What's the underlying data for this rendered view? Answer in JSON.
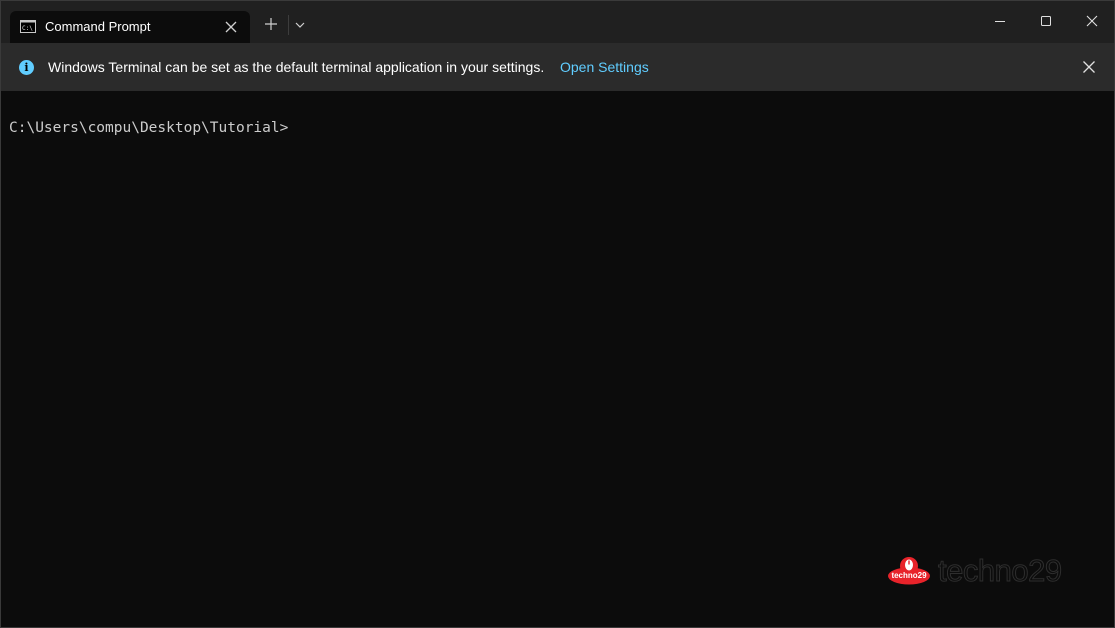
{
  "tab": {
    "title": "Command Prompt",
    "icon": "cmd-icon"
  },
  "titlebar": {
    "new_tab_icon": "plus-icon",
    "dropdown_icon": "chevron-down-icon",
    "minimize_icon": "minimize-icon",
    "maximize_icon": "maximize-icon",
    "close_icon": "close-icon"
  },
  "infobar": {
    "icon": "info-icon",
    "icon_glyph": "i",
    "message": "Windows Terminal can be set as the default terminal application in your settings.",
    "link_label": "Open Settings",
    "close_icon": "close-icon"
  },
  "terminal": {
    "prompt": "C:\\Users\\compu\\Desktop\\Tutorial>"
  },
  "watermark": {
    "badge_text": "techno29",
    "text": "techno29"
  },
  "colors": {
    "accent": "#60cdff",
    "terminal_bg": "#0c0c0c",
    "titlebar_bg": "#202020",
    "infobar_bg": "#2b2b2b",
    "terminal_fg": "#cccccc",
    "watermark_red": "#e8232a"
  }
}
